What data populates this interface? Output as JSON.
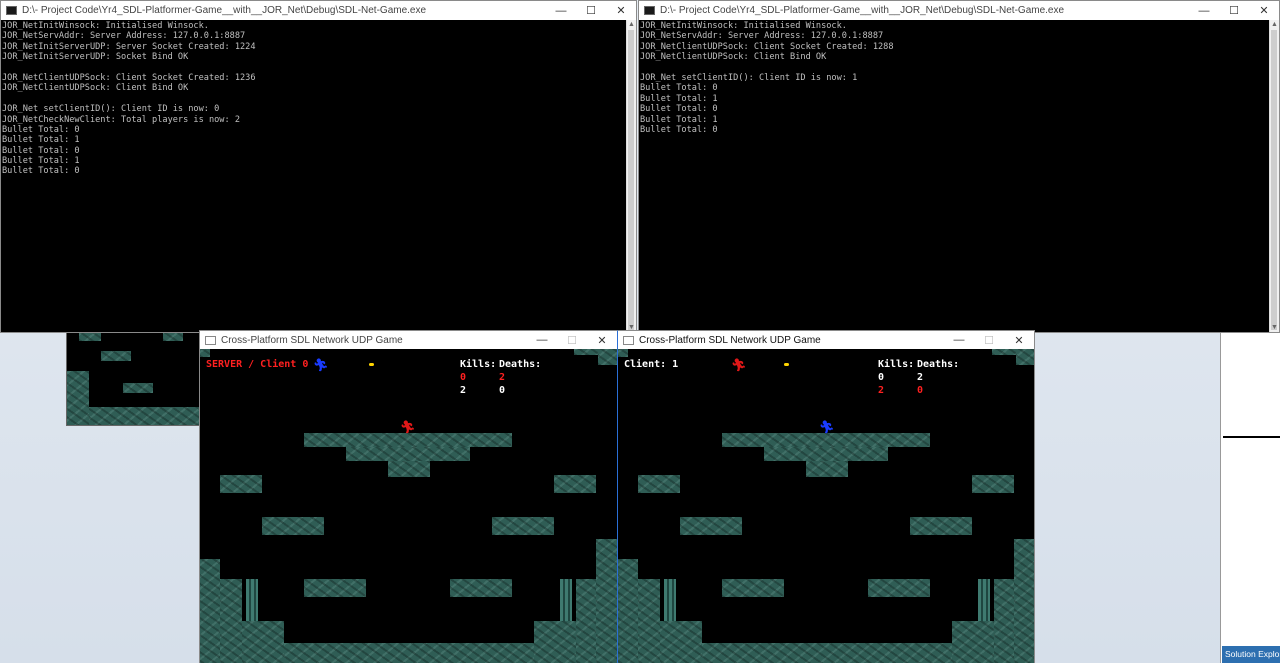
{
  "console_left": {
    "title": "D:\\- Project Code\\Yr4_SDL-Platformer-Game__with__JOR_Net\\Debug\\SDL-Net-Game.exe",
    "lines": [
      "JOR_NetInitWinsock: Initialised Winsock.",
      "JOR_NetServAddr: Server Address: 127.0.0.1:8887",
      "JOR_NetInitServerUDP: Server Socket Created: 1224",
      "JOR_NetInitServerUDP: Socket Bind OK",
      "",
      "JOR_NetClientUDPSock: Client Socket Created: 1236",
      "JOR_NetClientUDPSock: Client Bind OK",
      "",
      "JOR_Net setClientID(): Client ID is now: 0",
      "JOR_NetCheckNewClient: Total players is now: 2",
      "Bullet Total: 0",
      "Bullet Total: 1",
      "Bullet Total: 0",
      "Bullet Total: 1",
      "Bullet Total: 0"
    ]
  },
  "console_right": {
    "title": "D:\\- Project Code\\Yr4_SDL-Platformer-Game__with__JOR_Net\\Debug\\SDL-Net-Game.exe",
    "lines": [
      "JOR_NetInitWinsock: Initialised Winsock.",
      "JOR_NetServAddr: Server Address: 127.0.0.1:8887",
      "JOR_NetClientUDPSock: Client Socket Created: 1288",
      "JOR_NetClientUDPSock: Client Bind OK",
      "",
      "JOR_Net setClientID(): Client ID is now: 1",
      "Bullet Total: 0",
      "Bullet Total: 1",
      "Bullet Total: 0",
      "Bullet Total: 1",
      "Bullet Total: 0"
    ]
  },
  "window_controls": {
    "minimize": "—",
    "maximize": "☐",
    "close": "✕"
  },
  "game_left": {
    "title": "Cross-Platform SDL Network UDP Game",
    "role_label": "SERVER / Client 0",
    "kills_header": "Kills:",
    "deaths_header": "Deaths:",
    "scores": [
      {
        "kills": "0",
        "deaths": "2",
        "color": "#ff2020"
      },
      {
        "kills": "2",
        "deaths": "0",
        "color": "#ffffff"
      }
    ]
  },
  "game_right": {
    "title": "Cross-Platform SDL Network UDP Game",
    "role_label": "Client: 1",
    "kills_header": "Kills:",
    "deaths_header": "Deaths:",
    "scores": [
      {
        "kills": "0",
        "deaths": "2",
        "color": "#ffffff"
      },
      {
        "kills": "2",
        "deaths": "0",
        "color": "#ff2020"
      }
    ]
  },
  "colors": {
    "red_player": "#e01818",
    "blue_player": "#1a3cff",
    "bullet": "#ffd400",
    "tile": "#2f5d55"
  },
  "icons": {
    "player": "running-figure-icon"
  },
  "solution_explorer": {
    "label": "Solution Explorer"
  }
}
